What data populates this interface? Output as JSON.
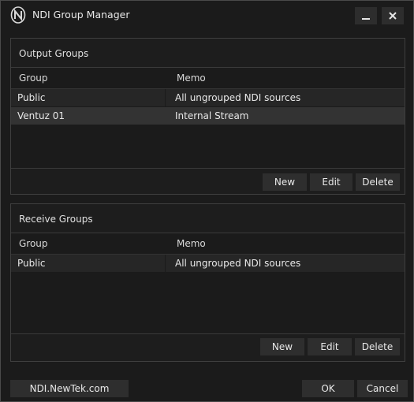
{
  "window": {
    "title": "NDI Group Manager",
    "minimize_label": "_",
    "close_label": "✕"
  },
  "output_groups": {
    "title": "Output Groups",
    "columns": [
      "Group",
      "Memo"
    ],
    "rows": [
      {
        "group": "Public",
        "memo": "All ungrouped NDI sources"
      },
      {
        "group": "Ventuz 01",
        "memo": "Internal Stream"
      }
    ],
    "buttons": {
      "new": "New",
      "edit": "Edit",
      "delete": "Delete"
    }
  },
  "receive_groups": {
    "title": "Receive Groups",
    "columns": [
      "Group",
      "Memo"
    ],
    "rows": [
      {
        "group": "Public",
        "memo": "All ungrouped NDI sources"
      }
    ],
    "buttons": {
      "new": "New",
      "edit": "Edit",
      "delete": "Delete"
    }
  },
  "footer": {
    "link_label": "NDI.NewTek.com",
    "ok_label": "OK",
    "cancel_label": "Cancel"
  },
  "colors": {
    "background": "#1b1b1b",
    "row": "#262626",
    "row_selected": "#333333",
    "button": "#2e2e2e",
    "text": "#e6e6e6"
  }
}
